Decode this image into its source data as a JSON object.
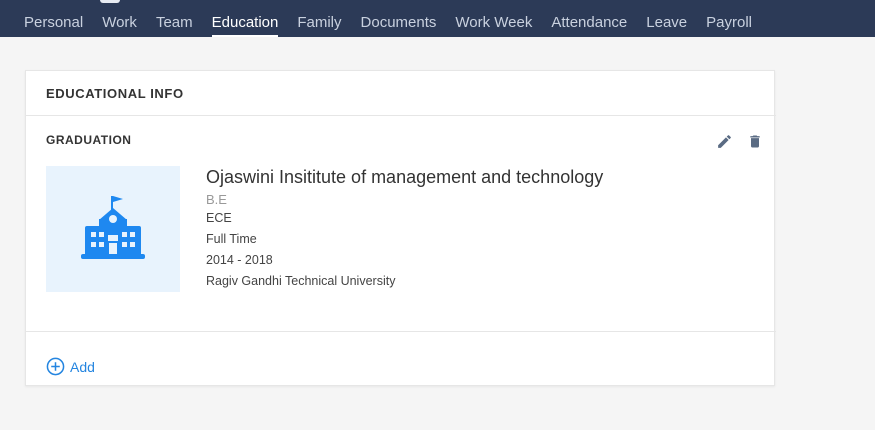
{
  "tabs": [
    {
      "label": "Personal",
      "active": false
    },
    {
      "label": "Work",
      "active": false
    },
    {
      "label": "Team",
      "active": false
    },
    {
      "label": "Education",
      "active": true
    },
    {
      "label": "Family",
      "active": false
    },
    {
      "label": "Documents",
      "active": false
    },
    {
      "label": "Work Week",
      "active": false
    },
    {
      "label": "Attendance",
      "active": false
    },
    {
      "label": "Leave",
      "active": false
    },
    {
      "label": "Payroll",
      "active": false
    }
  ],
  "card": {
    "title": "EDUCATIONAL INFO",
    "section_title": "GRADUATION",
    "entry": {
      "institution": "Ojaswini Insititute of management and technology",
      "degree": "B.E",
      "branch": "ECE",
      "mode": "Full Time",
      "years": "2014 - 2018",
      "university": "Ragiv Gandhi Technical University",
      "icon": "school-building-icon"
    },
    "actions": {
      "edit_icon": "edit-icon",
      "delete_icon": "delete-icon"
    },
    "add_label": "Add"
  },
  "colors": {
    "topbar": "#2c3a57",
    "accent": "#2485e0",
    "icon_tile_bg": "#e8f3fd",
    "school_icon": "#1e88f0",
    "action_icon": "#5a6b83"
  }
}
